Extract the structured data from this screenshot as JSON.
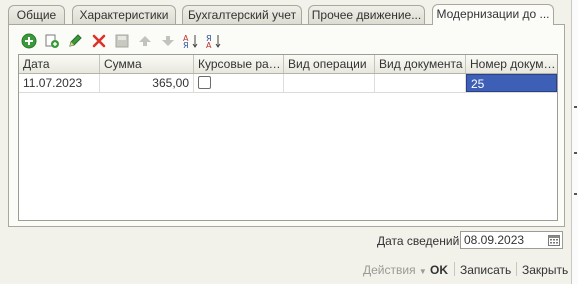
{
  "tabs": [
    {
      "label": "Общие",
      "active": false
    },
    {
      "label": "Характеристики",
      "active": false
    },
    {
      "label": "Бухгалтерский учет",
      "active": false
    },
    {
      "label": "Прочее движение...",
      "active": false
    },
    {
      "label": "Модернизации до ...",
      "active": true
    }
  ],
  "toolbar": {
    "icons": [
      "add-icon",
      "copy-icon",
      "edit-icon",
      "delete-icon",
      "save-icon",
      "move-up-icon",
      "move-down-icon",
      "sort-asc-icon",
      "sort-desc-icon"
    ]
  },
  "table": {
    "columns": [
      "Дата",
      "Сумма",
      "Курсовые разн...",
      "Вид операции",
      "Вид документа",
      "Номер докуме..."
    ],
    "rows": [
      {
        "date": "11.07.2023",
        "amount": "365,00",
        "fx_diff": false,
        "operation_type": "",
        "document_type": "",
        "document_number": "25"
      }
    ]
  },
  "info_date": {
    "label": "Дата сведений:",
    "value": "08.09.2023"
  },
  "footer": {
    "actions_label": "Действия",
    "ok_label": "OK",
    "save_label": "Записать",
    "close_label": "Закрыть"
  },
  "colors": {
    "selection": "#3d5fb5",
    "delete": "#d9342b",
    "add": "#3a9a3a"
  }
}
